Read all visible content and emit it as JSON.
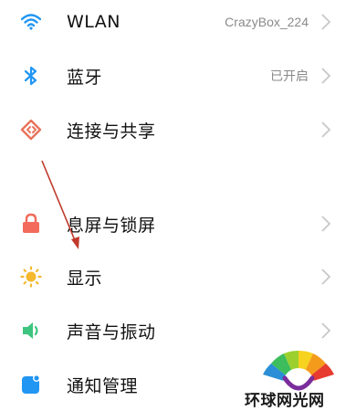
{
  "settings": {
    "items": [
      {
        "label": "WLAN",
        "value": "CrazyBox_224",
        "icon": "wifi-icon",
        "color": "#2196F3"
      },
      {
        "label": "蓝牙",
        "value": "已开启",
        "icon": "bluetooth-icon",
        "color": "#2196F3"
      },
      {
        "label": "连接与共享",
        "value": "",
        "icon": "share-icon",
        "color": "#E8735A"
      },
      {
        "label": "息屏与锁屏",
        "value": "",
        "icon": "lock-icon",
        "color": "#F26B5B"
      },
      {
        "label": "显示",
        "value": "",
        "icon": "sun-icon",
        "color": "#F5B82E"
      },
      {
        "label": "声音与振动",
        "value": "",
        "icon": "speaker-icon",
        "color": "#3DC47E"
      },
      {
        "label": "通知管理",
        "value": "",
        "icon": "notification-icon",
        "color": "#2196F3"
      }
    ]
  },
  "watermark": {
    "text": "环球网光网"
  },
  "colors": {
    "chevron": "#c8c8c8",
    "arrow": "#c0392b"
  }
}
